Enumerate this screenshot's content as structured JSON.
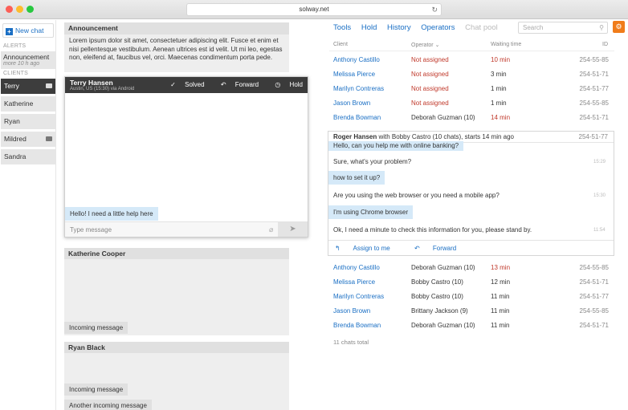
{
  "browser": {
    "url": "solway.net"
  },
  "sidebar": {
    "new_chat": "New chat",
    "alerts_label": "ALERTS",
    "announcement": {
      "title": "Announcement",
      "meta": "more 10 h ago"
    },
    "clients_label": "CLIENTS",
    "clients": [
      "Terry",
      "Katherine",
      "Ryan",
      "Mildred",
      "Sandra"
    ]
  },
  "announcement": {
    "title": "Announcement",
    "body": "Lorem ipsum dolor sit amet, consectetuer adipiscing elit. Fusce et enim et nisi pellentesque vestibulum. Aenean ultrices est id velit. Ut mi leo, egestas non, eleifend at, faucibus vel, orci. Maecenas condimentum porta pede."
  },
  "chat": {
    "name": "Terry Hansen",
    "meta": "Austin, US (15:30) via Android",
    "actions": {
      "solved": "Solved",
      "forward": "Forward",
      "hold": "Hold"
    },
    "message": "Hello! I need a little help here",
    "placeholder": "Type message"
  },
  "panels": [
    {
      "name": "Katherine Cooper",
      "messages": [
        "Incoming message"
      ]
    },
    {
      "name": "Ryan Black",
      "messages": [
        "Incoming message",
        "Another incoming message"
      ]
    }
  ],
  "nav": {
    "tabs": [
      "Tools",
      "Hold",
      "History",
      "Operators"
    ],
    "chat_pool": "Chat pool",
    "search_placeholder": "Search"
  },
  "table": {
    "headers": {
      "client": "Client",
      "operator": "Operator",
      "waiting": "Waiting time",
      "id": "ID"
    },
    "top_rows": [
      {
        "client": "Anthony Castillo",
        "operator": "Not assigned",
        "waiting": "10 min",
        "id": "254-55-85"
      },
      {
        "client": "Melissa Pierce",
        "operator": "Not assigned",
        "waiting": "3 min",
        "id": "254-51-71"
      },
      {
        "client": "Marilyn Contreras",
        "operator": "Not assigned",
        "waiting": "1 min",
        "id": "254-51-77"
      },
      {
        "client": "Jason Brown",
        "operator": "Not assigned",
        "waiting": "1 min",
        "id": "254-55-85"
      },
      {
        "client": "Brenda Bowman",
        "operator": "Deborah Guzman (10)",
        "waiting": "14 min",
        "id": "254-51-71"
      }
    ],
    "expanded": {
      "client": "Roger Hansen",
      "summary": "with Bobby Castro (10 chats), starts 14 min ago",
      "id": "254-51-77",
      "messages": [
        {
          "text": "Hello, can you help me with online banking?",
          "from": "user",
          "time": ""
        },
        {
          "text": "Sure, what's your problem?",
          "from": "operator",
          "time": "15:29"
        },
        {
          "text": "how to set it up?",
          "from": "user",
          "time": ""
        },
        {
          "text": "Are you using the web browser or you need a mobile app?",
          "from": "operator",
          "time": "15:30"
        },
        {
          "text": "I'm using Chrome browser",
          "from": "user",
          "time": ""
        },
        {
          "text": "Ok, I need a minute to check this information for you, please stand by.",
          "from": "operator",
          "time": "11:54"
        }
      ],
      "assign": "Assign to me",
      "forward": "Forward"
    },
    "bottom_rows": [
      {
        "client": "Anthony Castillo",
        "operator": "Deborah Guzman (10)",
        "waiting": "13 min",
        "id": "254-55-85"
      },
      {
        "client": "Melissa Pierce",
        "operator": "Bobby Castro (10)",
        "waiting": "12 min",
        "id": "254-51-71"
      },
      {
        "client": "Marilyn Contreras",
        "operator": "Bobby Castro (10)",
        "waiting": "11 min",
        "id": "254-51-77"
      },
      {
        "client": "Jason Brown",
        "operator": "Brittany Jackson (9)",
        "waiting": "11 min",
        "id": "254-55-85"
      },
      {
        "client": "Brenda Bowman",
        "operator": "Deborah Guzman (10)",
        "waiting": "11 min",
        "id": "254-51-71"
      }
    ],
    "total": "11 chats total"
  },
  "colors": {
    "accent": "#1a6fc4",
    "alert": "#c0392b",
    "orange": "#f07c1a",
    "user_bubble": "#d5e9f8"
  }
}
